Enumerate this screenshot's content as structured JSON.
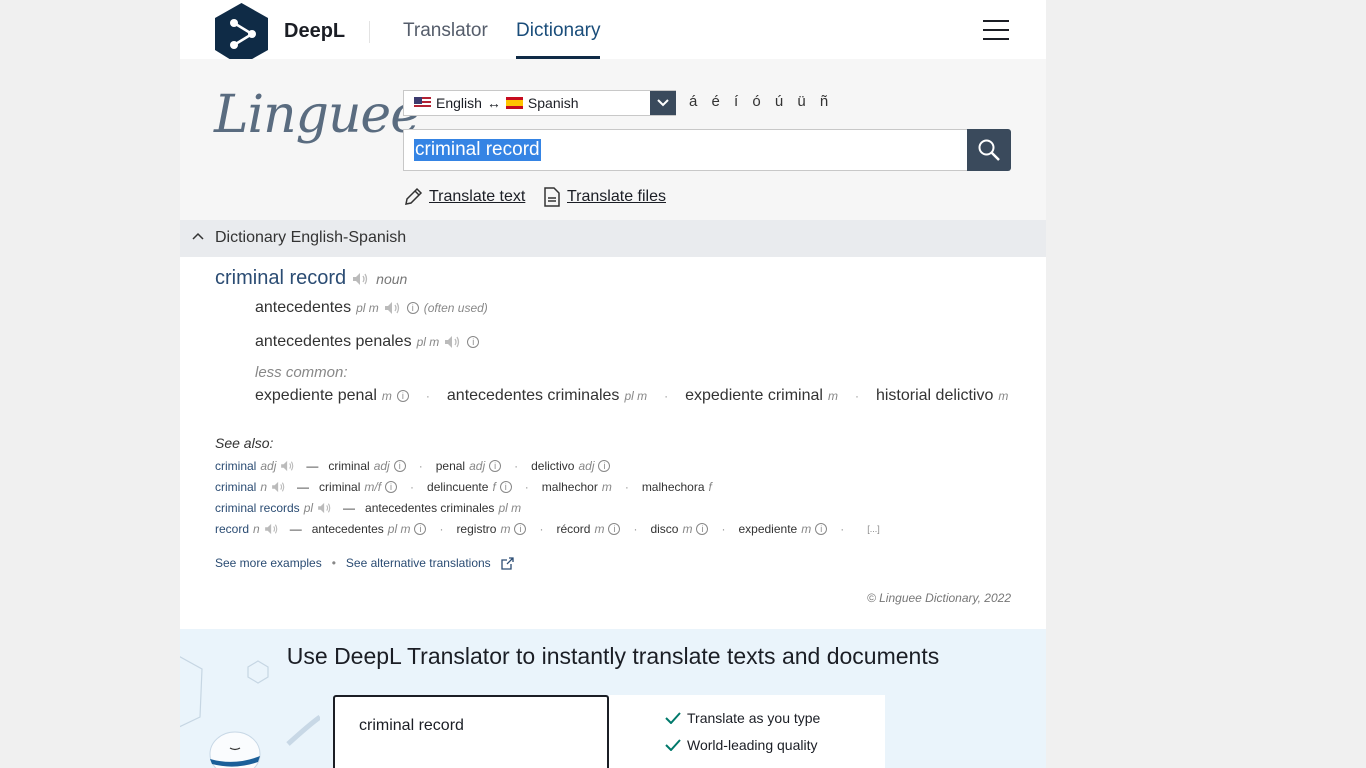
{
  "header": {
    "brand": "DeepL",
    "tabs": [
      {
        "label": "Translator"
      },
      {
        "label": "Dictionary"
      }
    ]
  },
  "linguee": {
    "logo_text": "Linguee",
    "lang_from": "English",
    "lang_arrow": "↔",
    "lang_to": "Spanish",
    "special_chars": "á é í ó ú ü ñ",
    "query": "criminal record",
    "translate_text": "Translate text",
    "translate_files": "Translate files"
  },
  "dictionary": {
    "header": "Dictionary English-Spanish",
    "headword": "criminal record",
    "headword_pos": "noun",
    "translations": [
      {
        "text": "antecedentes",
        "gram": "pl m",
        "note": "(often used)"
      },
      {
        "text": "antecedentes penales",
        "gram": "pl m"
      }
    ],
    "less_common_label": "less common:",
    "less_common": [
      {
        "text": "expediente penal",
        "gram": "m"
      },
      {
        "text": "antecedentes criminales",
        "gram": "pl m"
      },
      {
        "text": "expediente criminal",
        "gram": "m"
      },
      {
        "text": "historial delictivo",
        "gram": "m"
      }
    ],
    "see_also_label": "See also:",
    "see_also": [
      {
        "src": "criminal",
        "src_gram": "adj",
        "targets": [
          {
            "text": "criminal",
            "gram": "adj"
          },
          {
            "text": "penal",
            "gram": "adj"
          },
          {
            "text": "delictivo",
            "gram": "adj"
          }
        ]
      },
      {
        "src": "criminal",
        "src_gram": "n",
        "targets": [
          {
            "text": "criminal",
            "gram": "m/f"
          },
          {
            "text": "delincuente",
            "gram": "f"
          },
          {
            "text": "malhechor",
            "gram": "m"
          },
          {
            "text": "malhechora",
            "gram": "f"
          }
        ]
      },
      {
        "src": "criminal records",
        "src_gram": "pl",
        "targets": [
          {
            "text": "antecedentes criminales",
            "gram": "pl m"
          }
        ]
      },
      {
        "src": "record",
        "src_gram": "n",
        "targets": [
          {
            "text": "antecedentes",
            "gram": "pl m"
          },
          {
            "text": "registro",
            "gram": "m"
          },
          {
            "text": "récord",
            "gram": "m"
          },
          {
            "text": "disco",
            "gram": "m"
          },
          {
            "text": "expediente",
            "gram": "m"
          }
        ]
      }
    ],
    "ellipsis": "[...]",
    "see_more": "See more examples",
    "see_alternative": "See alternative translations",
    "copyright": "© Linguee Dictionary, 2022"
  },
  "promo": {
    "title": "Use DeepL Translator to instantly translate texts and documents",
    "box_text": "criminal record",
    "features": [
      "Translate as you type",
      "World-leading quality"
    ]
  },
  "colors": {
    "accent": "#0f2b46",
    "link": "#2b4c73",
    "selection": "#3584e4",
    "button": "#3a4a5c"
  }
}
